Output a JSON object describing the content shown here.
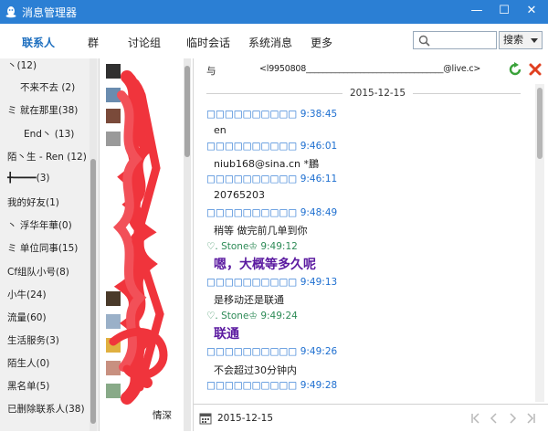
{
  "window": {
    "title": "消息管理器",
    "buttons": {
      "minimize": "—",
      "maximize": "☐",
      "close": "✕"
    }
  },
  "tabs": [
    {
      "label": "联系人",
      "active": true
    },
    {
      "label": "群"
    },
    {
      "label": "讨论组"
    },
    {
      "label": "临时会话"
    },
    {
      "label": "系统消息"
    },
    {
      "label": "更多"
    }
  ],
  "search": {
    "placeholder": "",
    "button_label": "搜索"
  },
  "groups": [
    "丶(12)",
    "不来不去 (2)",
    "ミ 就在那里(38)",
    "End丶 (13)",
    "陌丶生 - Ren (12)",
    "╋━━━━(3)",
    "我的好友(1)",
    "丶 浮华年華(0)",
    "ミ 单位同事(15)",
    "Cf组队小号(8)",
    "小牛(24)",
    "流量(60)",
    "生活服务(3)",
    "陌生人(0)",
    "黑名单(5)",
    "已删除联系人(38)"
  ],
  "contacts": {
    "last_name": "情深"
  },
  "chat": {
    "to_label": "与",
    "address": "<l9950808_________________________________@live.c>",
    "date": "2015-12-15",
    "messages": [
      {
        "sender": "□□□□□□□□□□",
        "time": "9:38:45",
        "text": "en",
        "self": true
      },
      {
        "sender": "□□□□□□□□□□",
        "time": "9:46:01",
        "text": "niub168@sina.cn  *鵬",
        "self": true
      },
      {
        "sender": "□□□□□□□□□□",
        "time": "9:46:11",
        "text": "20765203",
        "self": true
      },
      {
        "sender": "□□□□□□□□□□",
        "time": "9:48:49",
        "text": "稍等 做完前几单到你",
        "self": true
      },
      {
        "sender": "♡. Stone♔",
        "time": "9:49:12",
        "text": "嗯，大概等多久呢",
        "self": false
      },
      {
        "sender": "□□□□□□□□□□",
        "time": "9:49:13",
        "text": "是移动还是联通",
        "self": true
      },
      {
        "sender": "♡. Stone♔",
        "time": "9:49:24",
        "text": "联通",
        "self": false
      },
      {
        "sender": "□□□□□□□□□□",
        "time": "9:49:26",
        "text": "不会超过30分钟内",
        "self": true
      },
      {
        "sender": "□□□□□□□□□□",
        "time": "9:49:28",
        "text": "",
        "self": true
      }
    ],
    "footer_date": "2015-12-15"
  },
  "colors": {
    "titlebar": "#2b7fd4",
    "accent": "#1e6fbf",
    "scribble": "#f0343c",
    "big_text": "#5b1aa0"
  }
}
